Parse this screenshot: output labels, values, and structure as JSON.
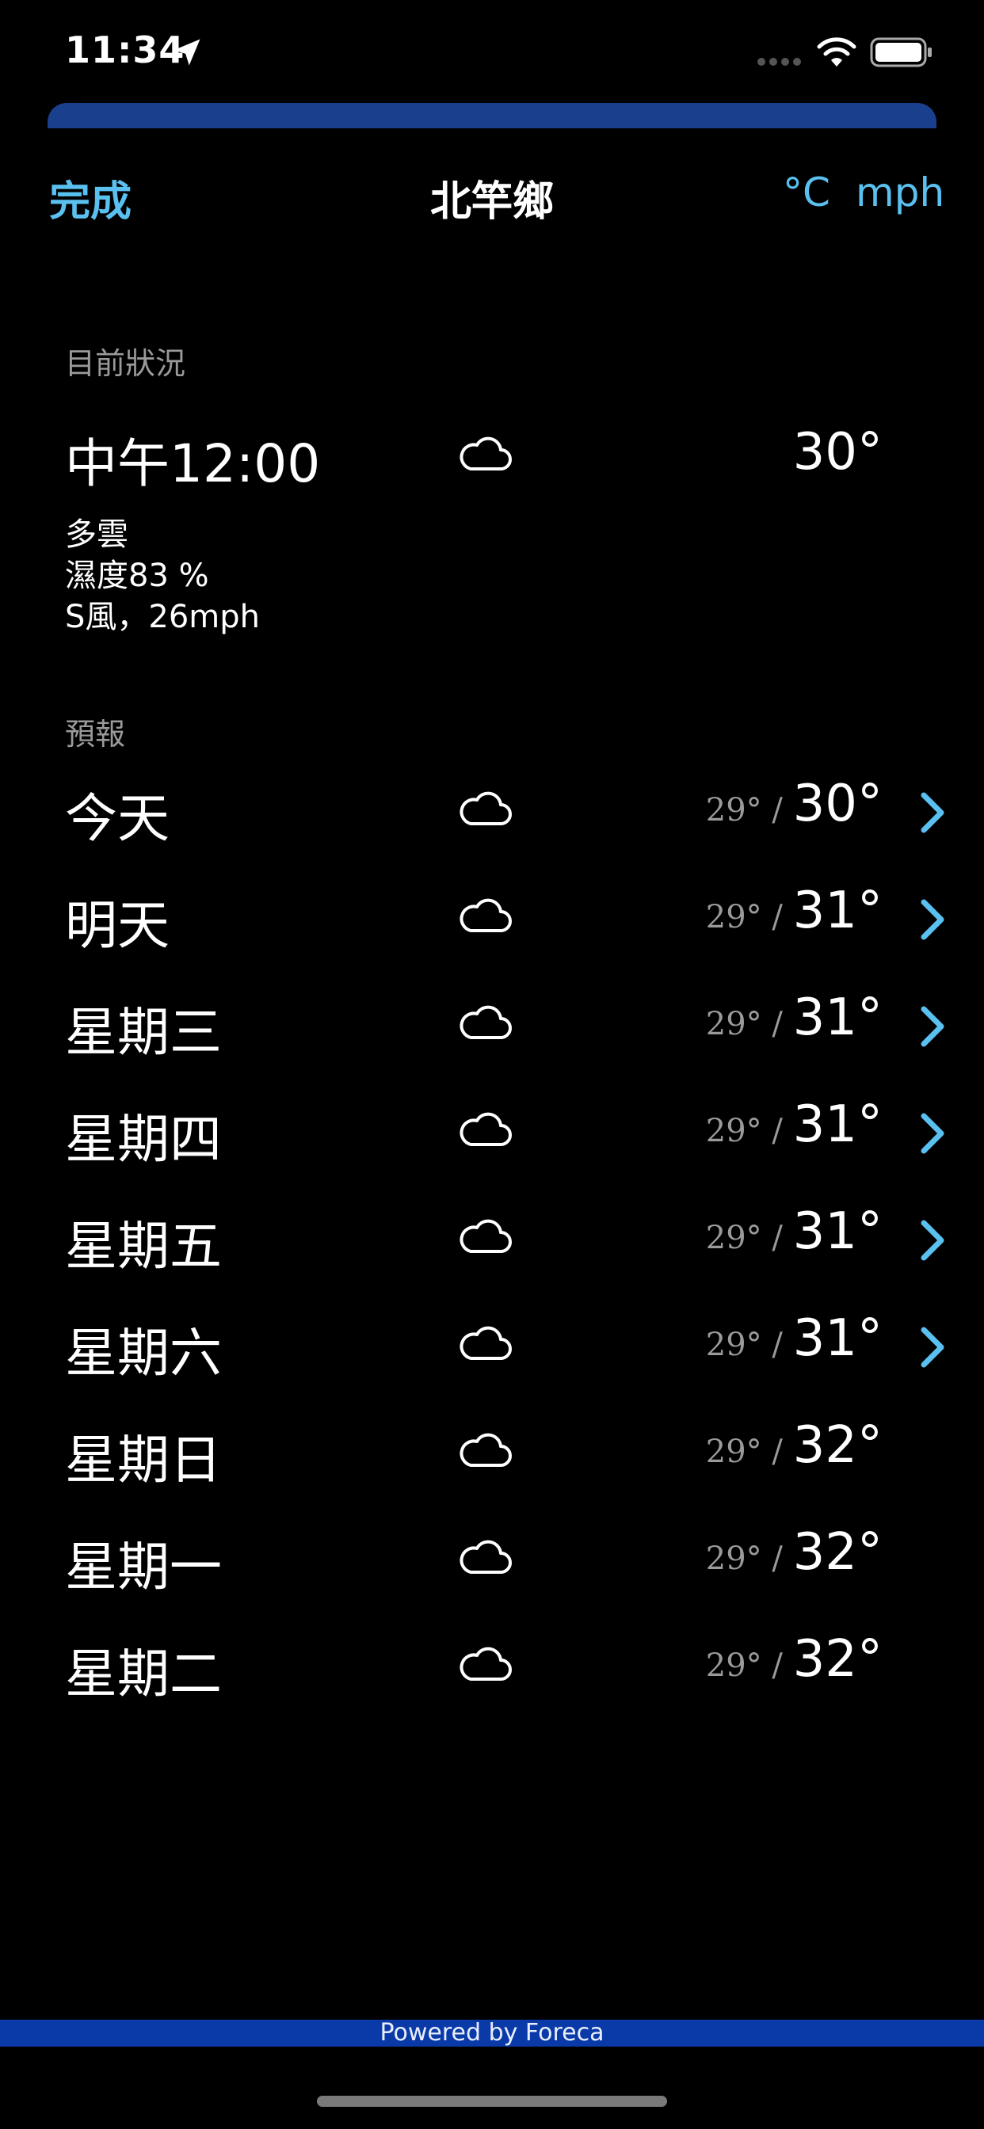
{
  "status": {
    "time": "11:34",
    "icons": [
      "location-arrow-icon",
      "signal-icon",
      "wifi-icon",
      "battery-icon"
    ]
  },
  "nav": {
    "done_label": "完成",
    "title": "北竿鄉",
    "unit_temp": "°C",
    "unit_speed": "mph"
  },
  "current": {
    "section_title": "目前狀況",
    "time": "中午12:00",
    "icon": "cloud-icon",
    "temp": "30°",
    "condition": "多雲",
    "humidity": "濕度83 %",
    "wind": "S風，26mph"
  },
  "forecast": {
    "section_title": "預報",
    "days": [
      {
        "day": "今天",
        "icon": "cloud-icon",
        "low": "29°",
        "high": "30°",
        "has_detail": true
      },
      {
        "day": "明天",
        "icon": "cloud-icon",
        "low": "29°",
        "high": "31°",
        "has_detail": true
      },
      {
        "day": "星期三",
        "icon": "cloud-icon",
        "low": "29°",
        "high": "31°",
        "has_detail": true
      },
      {
        "day": "星期四",
        "icon": "cloud-icon",
        "low": "29°",
        "high": "31°",
        "has_detail": true
      },
      {
        "day": "星期五",
        "icon": "cloud-icon",
        "low": "29°",
        "high": "31°",
        "has_detail": true
      },
      {
        "day": "星期六",
        "icon": "cloud-icon",
        "low": "29°",
        "high": "31°",
        "has_detail": true
      },
      {
        "day": "星期日",
        "icon": "cloud-icon",
        "low": "29°",
        "high": "32°",
        "has_detail": false
      },
      {
        "day": "星期一",
        "icon": "cloud-icon",
        "low": "29°",
        "high": "32°",
        "has_detail": false
      },
      {
        "day": "星期二",
        "icon": "cloud-icon",
        "low": "29°",
        "high": "32°",
        "has_detail": false
      }
    ]
  },
  "footer": {
    "text": "Powered by Foreca"
  },
  "colors": {
    "background": "#000000",
    "accent": "#5ac0f0",
    "footer_bar": "#0a3aa8",
    "sheet_strip": "#1a3f8c",
    "secondary_text": "#9a9a9a"
  }
}
